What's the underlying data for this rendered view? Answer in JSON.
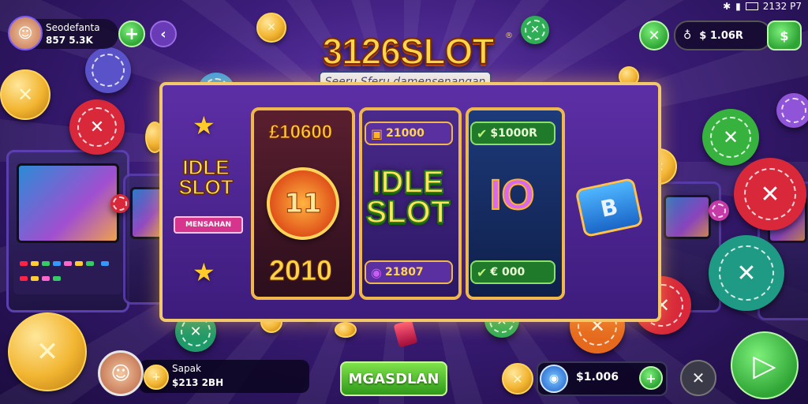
{
  "top_left": {
    "username": "Seodefanta",
    "balance": "857 5.3K"
  },
  "status_bar": {
    "time": "2132 P7"
  },
  "top_right": {
    "balance": "$ 1.06R"
  },
  "logo": {
    "title": "3126SLOT",
    "subtitle": "Seeru Sferu damensenangan"
  },
  "board": {
    "side_logo_line1": "IDLE",
    "side_logo_line2": "SLOT",
    "side_logo_sub": "MENSAHAN",
    "reel1": {
      "top_value": "£10600",
      "chip_number": "11",
      "bottom_value": "2010"
    },
    "reel2": {
      "top_value": "21000",
      "center_line1": "IDLE",
      "center_line2": "SLOT",
      "bottom_value": "21807"
    },
    "reel3": {
      "top_value": "$1000R",
      "center_symbol": "IO",
      "bottom_value": "€ 000"
    }
  },
  "bottom": {
    "player_name": "Sapak",
    "player_balance": "$213 2BH",
    "main_button": "MGASDLAN",
    "wallet_value": "$1.006"
  },
  "colors": {
    "accent_gold": "#ffd54a",
    "accent_green": "#2fa536",
    "accent_purple": "#6a3bb7"
  }
}
